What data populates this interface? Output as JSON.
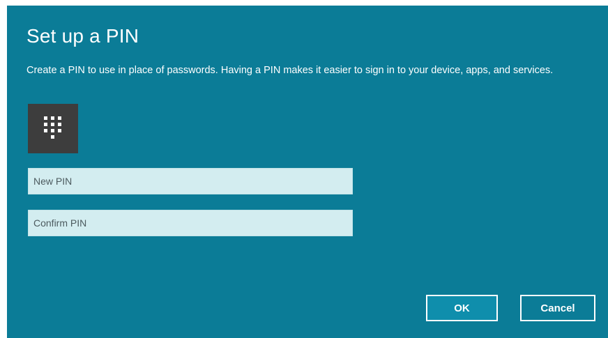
{
  "dialog": {
    "title": "Set up a PIN",
    "description": "Create a PIN to use in place of passwords. Having a PIN makes it easier to sign in to your device, apps, and services.",
    "icon": "keypad-icon",
    "new_pin": {
      "placeholder": "New PIN",
      "value": ""
    },
    "confirm_pin": {
      "placeholder": "Confirm PIN",
      "value": ""
    },
    "buttons": {
      "ok_label": "OK",
      "cancel_label": "Cancel"
    }
  },
  "colors": {
    "background": "#0b7c97",
    "keypad_tile": "#3d3d3d",
    "input_fill": "#d3edf0",
    "button_ok_fill": "#0f8eac",
    "text": "#ffffff"
  }
}
